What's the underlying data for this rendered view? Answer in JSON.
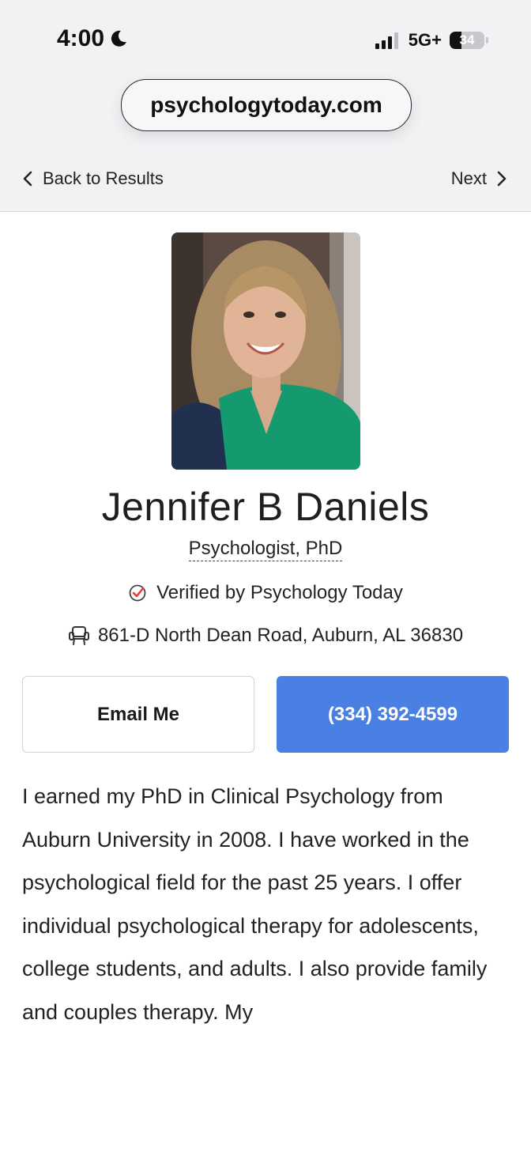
{
  "status_bar": {
    "time": "4:00",
    "network": "5G+",
    "battery": "34",
    "battery_level": 0.34
  },
  "browser": {
    "url": "psychologytoday.com"
  },
  "nav": {
    "back_label": "Back to Results",
    "next_label": "Next"
  },
  "profile": {
    "name": "Jennifer B Daniels",
    "credentials": "Psychologist, PhD",
    "verified_text": "Verified by Psychology Today",
    "address": "861-D North Dean Road, Auburn, AL 36830"
  },
  "actions": {
    "email_label": "Email Me",
    "phone_label": "(334) 392-4599"
  },
  "bio": "I earned my PhD in Clinical Psychology from Auburn University in 2008. I have worked in the psychological field for the past 25 years. I offer individual psychological therapy for adolescents, college students, and adults. I also provide family and couples therapy. My",
  "colors": {
    "primary_button": "#4a7fe3",
    "verified_check": "#e0403a"
  },
  "icons": [
    "moon-icon",
    "signal-icon",
    "battery-icon",
    "chevron-left-icon",
    "chevron-right-icon",
    "verified-check-icon",
    "office-chair-icon"
  ]
}
